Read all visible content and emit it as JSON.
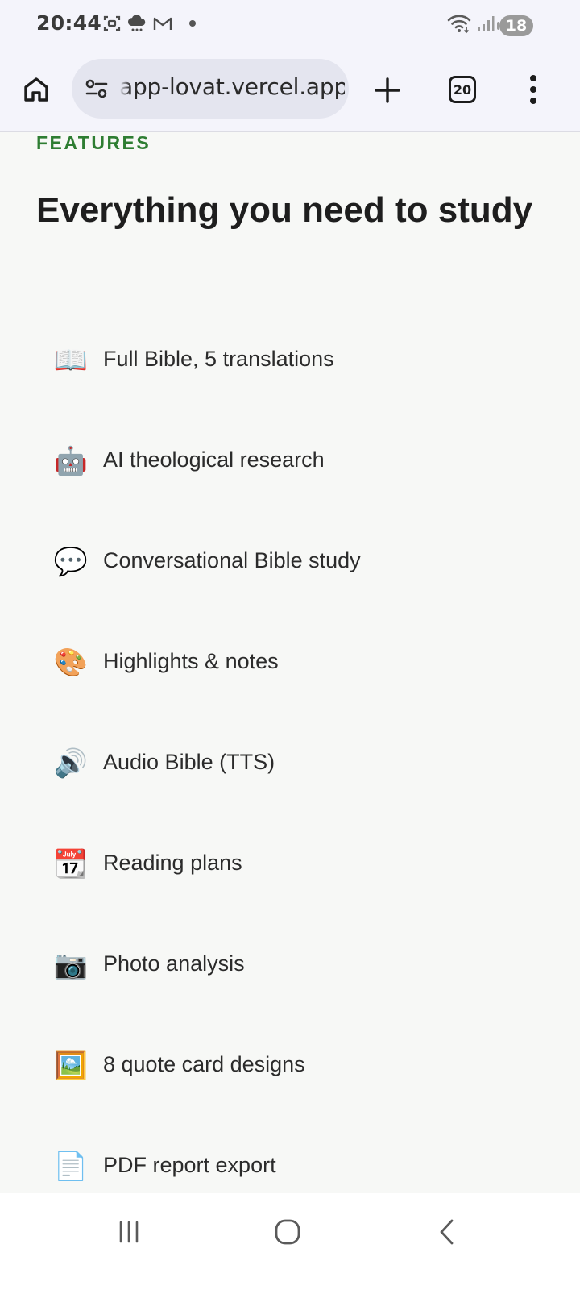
{
  "status_bar": {
    "time": "20:44",
    "battery": "18",
    "icons": [
      "screenshot-icon",
      "cloud-rain-icon",
      "gmail-icon",
      "notification-dot-icon",
      "wifi-icon",
      "signal-icon",
      "battery-icon"
    ]
  },
  "browser": {
    "url": "app-lovat.vercel.app",
    "tab_count": "20",
    "icons": [
      "home-icon",
      "site-settings-icon",
      "plus-icon",
      "tabs-icon",
      "more-vert-icon"
    ]
  },
  "page": {
    "eyebrow": "FEATURES",
    "heading": "Everything you need to study",
    "features": [
      {
        "icon": "📖",
        "icon_name": "open-book-icon",
        "label": "Full Bible, 5 translations"
      },
      {
        "icon": "🤖",
        "icon_name": "robot-icon",
        "label": "AI theological research"
      },
      {
        "icon": "💬",
        "icon_name": "speech-bubble-icon",
        "label": "Conversational Bible study"
      },
      {
        "icon": "🎨",
        "icon_name": "palette-icon",
        "label": "Highlights & notes"
      },
      {
        "icon": "🔊",
        "icon_name": "speaker-icon",
        "label": "Audio Bible (TTS)"
      },
      {
        "icon": "📆",
        "icon_name": "calendar-icon",
        "label": "Reading plans"
      },
      {
        "icon": "📷",
        "icon_name": "camera-icon",
        "label": "Photo analysis"
      },
      {
        "icon": "🖼️",
        "icon_name": "framed-picture-icon",
        "label": "8 quote card designs"
      },
      {
        "icon": "📄",
        "icon_name": "document-icon",
        "label": "PDF report export"
      }
    ]
  },
  "nav_bar": {
    "icons": [
      "recent-apps-icon",
      "home-circle-icon",
      "back-icon"
    ]
  },
  "colors": {
    "accent": "#2e7d32",
    "page_background": "#f7f8f6",
    "toolbar_background": "#f4f4fb",
    "url_bar_background": "#e4e5ef"
  }
}
